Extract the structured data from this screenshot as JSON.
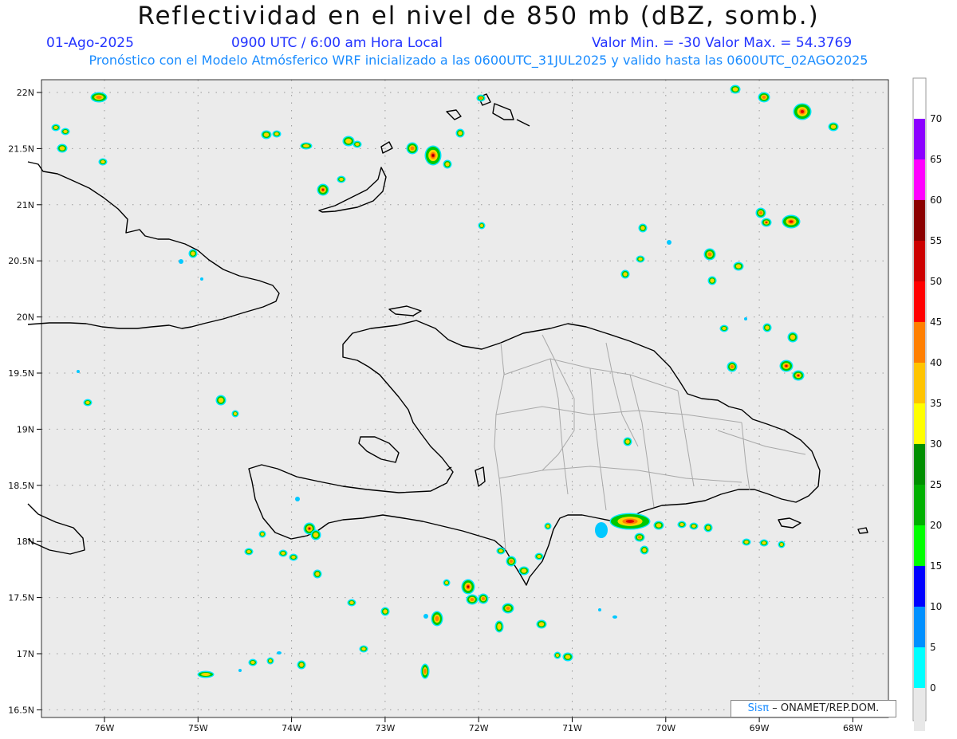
{
  "header": {
    "title": "Reflectividad en el nivel de 850 mb (dBZ, somb.)",
    "date": "01-Ago-2025",
    "time": "0900 UTC / 6:00 am Hora Local",
    "stats": "Valor Min. = -30  Valor Max. = 54.3769",
    "forecast_note": "Pronóstico con el Modelo Atmósferico WRF inicializado a las 0600UTC_31JUL2025 y valido hasta las  0600UTC_02AGO2025"
  },
  "map": {
    "lat_labels": [
      "22N",
      "21.5N",
      "21N",
      "20.5N",
      "20N",
      "19.5N",
      "19N",
      "18.5N",
      "18N",
      "17.5N",
      "17N",
      "16.5N"
    ],
    "lon_labels": [
      "76W",
      "75W",
      "74W",
      "73W",
      "72W",
      "71W",
      "70W",
      "69W",
      "68W"
    ],
    "background_color": "#ebebeb",
    "coast_color": "#000000",
    "province_color": "#a8a8a8"
  },
  "colorbar": {
    "labels": [
      "70",
      "65",
      "60",
      "55",
      "50",
      "45",
      "40",
      "35",
      "30",
      "25",
      "20",
      "15",
      "10",
      "5",
      "0"
    ],
    "colors": [
      "#8c00ff",
      "#ff00ff",
      "#8b0000",
      "#cc0000",
      "#ff0000",
      "#ff7f00",
      "#ffc400",
      "#ffff00",
      "#008f00",
      "#00b000",
      "#00ff00",
      "#0000ff",
      "#0090ff",
      "#00ffff",
      "#e8e8e8"
    ]
  },
  "credit": {
    "brand": "Sisπ",
    "text": "– ONAMET/REP.DOM."
  }
}
